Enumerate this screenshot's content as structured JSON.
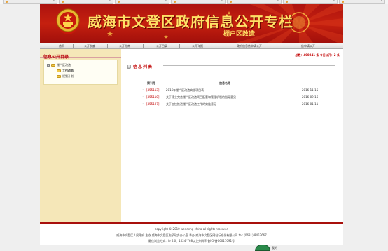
{
  "banner": {
    "title": "威海市文登区政府信息公开专栏",
    "subtitle": "棚户区改造"
  },
  "nav": {
    "items": [
      "首页",
      "公开制度",
      "公开指南",
      "公开目录",
      "公开年报",
      "政府信息依申请公开",
      "依申请公开"
    ]
  },
  "sidebar": {
    "title": "信息公开目录",
    "tree": {
      "root": "棚户区改造",
      "children": [
        "工作动态",
        "规划计划"
      ]
    }
  },
  "main": {
    "stats": "总数：400841 条  今日公开：2 条",
    "list_title": "信息列表",
    "columns": {
      "code": "索引号",
      "title": "信息名称"
    },
    "rows": [
      {
        "code": "[455113]",
        "title": "2016年棚户区改造实施项目表",
        "date": "2016-11-15"
      },
      {
        "code": "[455110]",
        "title": "关于建立完善棚户区改造项目配套和管理机制的指导意见",
        "date": "2016-09-16"
      },
      {
        "code": "[455107]",
        "title": "关于加快推进棚户区改造工作的实施意见",
        "date": "2016-01-11"
      }
    ]
  },
  "footer": {
    "line1": "copyright © 2010 wendeng china all rights reserved",
    "line2": "威海市文登区人民政府 主办 威海市文登区电子政务办公室 承办 威海市文登区网站标准化有限公司 tel: (0631) 8452667",
    "line3": "最佳浏览方式：ie 6.0、1024*768以上分辨率 鲁ICP备06017091号"
  },
  "badge": {
    "label": "我的"
  }
}
